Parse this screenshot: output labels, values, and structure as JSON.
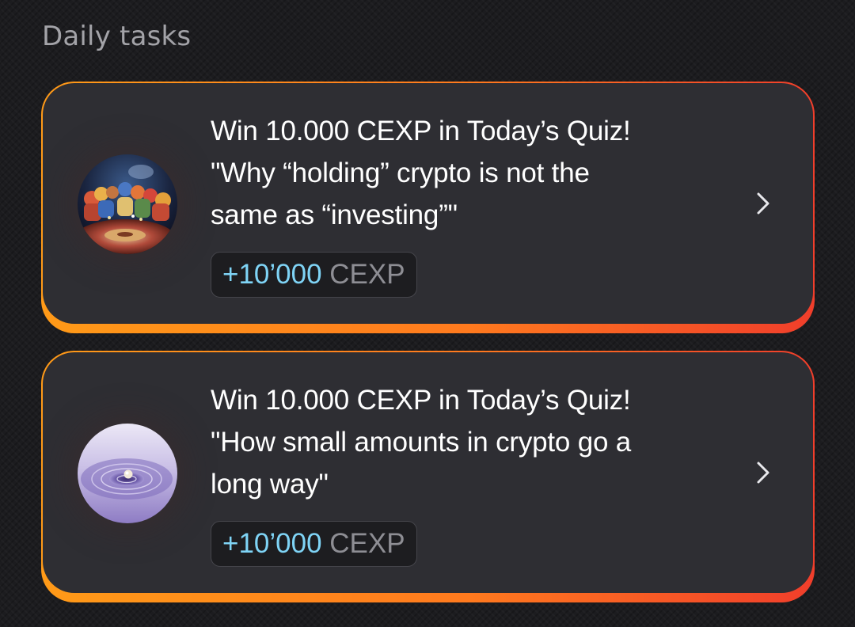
{
  "section": {
    "title": "Daily tasks"
  },
  "tasks": [
    {
      "line1": "Win 10.000 CEXP in Today’s Quiz!",
      "line2": "\"Why “holding” crypto is not the",
      "line3": "same as “investing”\"",
      "reward_amount": "+10’000",
      "reward_unit": "CEXP",
      "thumbnail": "casino-roulette-scene",
      "action_icon": "chevron-right-icon"
    },
    {
      "line1": "Win 10.000 CEXP in Today’s Quiz!",
      "line2": "\"How small amounts in crypto go a",
      "line3": "long way\"",
      "reward_amount": "+10’000",
      "reward_unit": "CEXP",
      "thumbnail": "purple-ripple-coin",
      "action_icon": "chevron-right-icon"
    }
  ],
  "colors": {
    "background": "#1c1c1f",
    "card": "#2e2e33",
    "border_gradient_start": "#ff9a18",
    "border_gradient_end": "#f03e2b",
    "reward_amount": "#7fd4f6",
    "reward_unit": "#8e8e94",
    "title": "#a3a3a8"
  }
}
